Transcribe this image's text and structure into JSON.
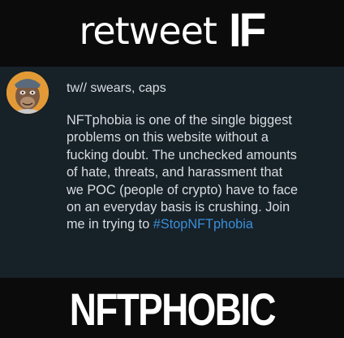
{
  "meme": {
    "top_text": "retweet",
    "top_emphasis": "IF",
    "bottom_text": "NFTPHOBIC"
  },
  "tweet": {
    "avatar_icon": "ape-nft-avatar-icon",
    "content_warning": "tw// swears, caps",
    "body_lines": [
      "NFTphobia is one of the single biggest",
      "problems on this website without a",
      "fucking doubt. The unchecked amounts",
      "of hate, threats, and harassment that",
      "we POC (people of crypto) have to face",
      "on an everyday basis is crushing. Join"
    ],
    "last_line_prefix": "me in trying to ",
    "hashtag": "#StopNFTphobia"
  },
  "colors": {
    "background": "#0b0b0b",
    "tweet_panel": "#172128",
    "tweet_text": "#d8dde1",
    "hashtag": "#3a8fd9",
    "avatar_bg": "#e39a36"
  }
}
